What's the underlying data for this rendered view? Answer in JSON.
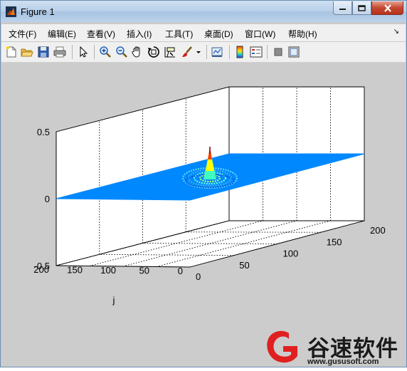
{
  "window": {
    "title": "Figure 1",
    "caption_buttons": [
      "minimize",
      "maximize",
      "close"
    ]
  },
  "menu": {
    "items": [
      "文件(F)",
      "编辑(E)",
      "查看(V)",
      "插入(I)",
      "工具(T)",
      "桌面(D)",
      "窗口(W)",
      "帮助(H)"
    ]
  },
  "toolbar": {
    "icons": [
      "new-figure-icon",
      "open-file-icon",
      "save-icon",
      "print-icon",
      "edit-plot-arrow-icon",
      "zoom-in-icon",
      "zoom-out-icon",
      "pan-hand-icon",
      "rotate-3d-icon",
      "data-cursor-icon",
      "brush-icon",
      "brush-dropdown-icon",
      "link-plot-icon",
      "colorbar-icon",
      "legend-icon",
      "hide-plot-tools-icon",
      "show-plot-tools-icon"
    ]
  },
  "plot": {
    "type": "3d-surface",
    "z_ticks": [
      "0.5",
      "0",
      "-0.5"
    ],
    "y_ticks": [
      "200",
      "150",
      "100",
      "50",
      "0"
    ],
    "x_ticks": [
      "0",
      "50",
      "100",
      "150",
      "200"
    ],
    "y_label": "j",
    "z_range": [
      -0.5,
      0.5
    ],
    "x_range": [
      0,
      200
    ],
    "y_range": [
      0,
      200
    ],
    "surface_color": "#0088ff",
    "peak_colors": [
      "#8b0000",
      "#ff4000",
      "#ffff00",
      "#40ffbf",
      "#00bfff"
    ],
    "grid": true
  },
  "watermark": {
    "text": "谷速软件",
    "url": "www.gususoft.com",
    "color": "#e02020"
  }
}
